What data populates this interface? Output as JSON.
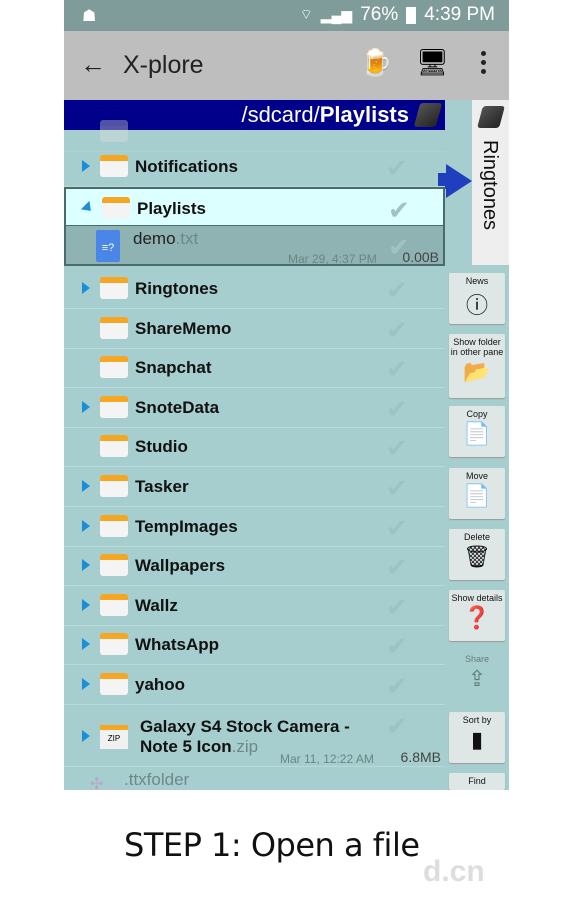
{
  "status": {
    "battery": "76%",
    "time": "4:39 PM"
  },
  "toolbar": {
    "title": "X-plore"
  },
  "path": {
    "prefix": "/sdcard/",
    "current": "Playlists"
  },
  "other_pane": {
    "label": "Ringtones"
  },
  "files": [
    {
      "name": "Notifications",
      "expandable": true
    },
    {
      "name": "Playlists",
      "expandable": true,
      "expanded": true,
      "selected": true
    },
    {
      "name": "Ringtones",
      "expandable": true
    },
    {
      "name": "ShareMemo",
      "expandable": false
    },
    {
      "name": "Snapchat",
      "expandable": false
    },
    {
      "name": "SnoteData",
      "expandable": true
    },
    {
      "name": "Studio",
      "expandable": false
    },
    {
      "name": "Tasker",
      "expandable": true
    },
    {
      "name": "TempImages",
      "expandable": true
    },
    {
      "name": "Wallpapers",
      "expandable": true
    },
    {
      "name": "Wallz",
      "expandable": true
    },
    {
      "name": "WhatsApp",
      "expandable": true
    },
    {
      "name": "yahoo",
      "expandable": true
    }
  ],
  "demo_file": {
    "name": "demo",
    "ext": ".txt",
    "date": "Mar 29, 4:37 PM",
    "size": "0.00B"
  },
  "zip_file": {
    "line1": "Galaxy S4 Stock Camera -",
    "line2": "Note 5 Icon",
    "ext": ".zip",
    "date": "Mar 11, 12:22 AM",
    "size": "6.8MB"
  },
  "hidden_folder": {
    "name": ".ttxfolder"
  },
  "actions": [
    {
      "label": "News",
      "icon": "info-icon"
    },
    {
      "label": "Show folder in other pane",
      "icon": "show-folder-icon"
    },
    {
      "label": "Copy",
      "icon": "copy-icon"
    },
    {
      "label": "Move",
      "icon": "move-icon"
    },
    {
      "label": "Delete",
      "icon": "trash-icon"
    },
    {
      "label": "Show details",
      "icon": "details-icon"
    },
    {
      "label": "Share",
      "icon": "share-icon",
      "disabled": true
    },
    {
      "label": "Sort by",
      "icon": "sort-icon"
    },
    {
      "label": "Find",
      "icon": "find-icon"
    }
  ],
  "caption": "STEP 1: Open a file",
  "watermark": "d.cn"
}
